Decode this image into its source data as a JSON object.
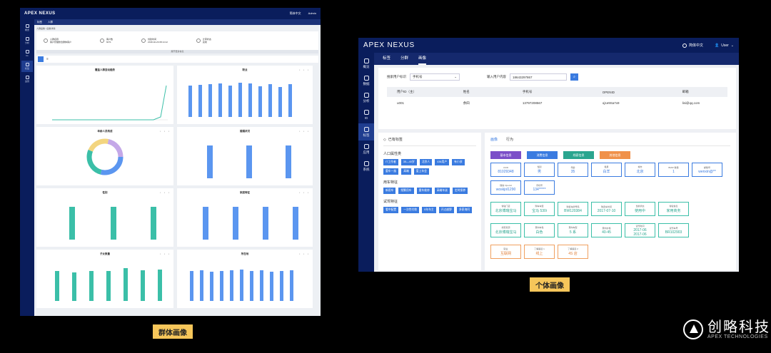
{
  "left_screen": {
    "app_title": "APEX NEXUS",
    "lang": "简体中文",
    "user": "Admin",
    "sidebar": [
      "概览",
      "分析",
      "IG",
      "标签",
      "运营",
      "系统",
      "标签",
      "IG"
    ],
    "tabs": [
      "标签",
      "人群"
    ],
    "breadcrumb": "人群画像 / 画像详情",
    "info": [
      {
        "label": "人群名称",
        "value": "客户管理整合群体客户"
      },
      {
        "label": "客户数",
        "value": "6071"
      },
      {
        "label": "创建时间",
        "value": "2018-02-29 08:14:12"
      },
      {
        "label": "计算状态",
        "value": "完成"
      }
    ],
    "more": "展开更多信息",
    "panels": [
      "覆盖人群变动趋势",
      "职业",
      "年龄人员构成",
      "婚姻状况",
      "性别",
      "家庭特征",
      "子女数量",
      "所在地"
    ]
  },
  "right_screen": {
    "app_title": "APEX NEXUS",
    "lang": "简体中文",
    "user": "User",
    "sidebar": [
      "概览",
      "数据",
      "分析",
      "IG",
      "标签",
      "应用",
      "系统"
    ],
    "tabs": [
      "标签",
      "分群",
      "画像"
    ],
    "search_id_label": "搜索用户标识",
    "search_id_value": "手机号",
    "search_input_label": "输入用户内容",
    "search_input_value": "18643297867",
    "table": {
      "headers": [
        "用户ID（主）",
        "姓名",
        "手机号",
        "OPENID",
        "邮箱"
      ],
      "row": [
        "u001",
        "余四",
        "13797208567",
        "oj1e9Sa7x9",
        "lisi@qq.com"
      ]
    },
    "tags_title": "已有标签",
    "groups": [
      {
        "name": "人口属性类",
        "tags": [
          "IT工作者",
          "35—40岁",
          "北京人",
          "436用户",
          "有小孩",
          "重车一族",
          "高端",
          "爱上年会"
        ]
      },
      {
        "name": "用车特征",
        "tags": [
          "新用车",
          "频繁用车",
          "重车维修",
          "高端车迷",
          "定时保养"
        ]
      },
      {
        "name": "试驾特征",
        "tags": [
          "看中配置",
          "一次性付款",
          "5年车主",
          "开过越野",
          "多家询问"
        ]
      }
    ],
    "right_tabs": [
      "画像",
      "行为"
    ],
    "categories": [
      {
        "label": "基本信息",
        "color": "#7b4fc8"
      },
      {
        "label": "消费信息",
        "color": "#3a7be0"
      },
      {
        "label": "线索信息",
        "color": "#2aa58f"
      },
      {
        "label": "其他信息",
        "color": "#f0914a"
      }
    ],
    "cards": [
      {
        "label": "UUID",
        "value": "81029348",
        "style": "b"
      },
      {
        "label": "性别",
        "value": "男",
        "style": "b"
      },
      {
        "label": "年龄",
        "value": "35",
        "style": "b"
      },
      {
        "label": "籍贯",
        "value": "白羊",
        "style": "b"
      },
      {
        "label": "城市",
        "value": "北京",
        "style": "b"
      },
      {
        "label": "BMW 数量",
        "value": "1",
        "style": "b"
      },
      {
        "label": "邮箱号",
        "value": "wenxin@**",
        "style": "b"
      },
      {
        "label": "微信 Openid",
        "value": "woskjol1290",
        "style": "b"
      },
      {
        "label": "手机号",
        "value": "134*****",
        "style": "b"
      },
      {
        "label": "常驻门店",
        "value": "北京博瑞宝马",
        "style": "g",
        "brk": true
      },
      {
        "label": "购车车型",
        "value": "宝马 530i",
        "style": "g"
      },
      {
        "label": "购置车牌号码",
        "value": "BW120384",
        "style": "g"
      },
      {
        "label": "购置车时间",
        "value": "2017-07-10",
        "style": "g"
      },
      {
        "label": "当前状态",
        "value": "使用中",
        "style": "g"
      },
      {
        "label": "常驻信息",
        "value": "家用商务",
        "style": "g"
      },
      {
        "label": "线索来源",
        "value": "北京博瑞宝马",
        "style": "g",
        "brk": true
      },
      {
        "label": "意向车色",
        "value": "白色",
        "style": "g"
      },
      {
        "label": "意向车型",
        "value": "5 系",
        "style": "g"
      },
      {
        "label": "意向价格",
        "value": "40-45",
        "style": "g"
      },
      {
        "label": "试驾时间",
        "value": "2017-06\n2017-06",
        "style": "g"
      },
      {
        "label": "试驾车号",
        "value": "BR102903",
        "style": "g"
      },
      {
        "label": "职业",
        "value": "互联网",
        "style": "o",
        "brk": true
      },
      {
        "label": "了解渠道 1",
        "value": "线上",
        "style": "o"
      },
      {
        "label": "了解渠道 2",
        "value": "4S 店",
        "style": "o"
      }
    ]
  },
  "captions": {
    "left": "群体画像",
    "right": "个体画像"
  },
  "brand": {
    "name": "创略科技",
    "sub": "APEX TECHNOLOGIES"
  }
}
